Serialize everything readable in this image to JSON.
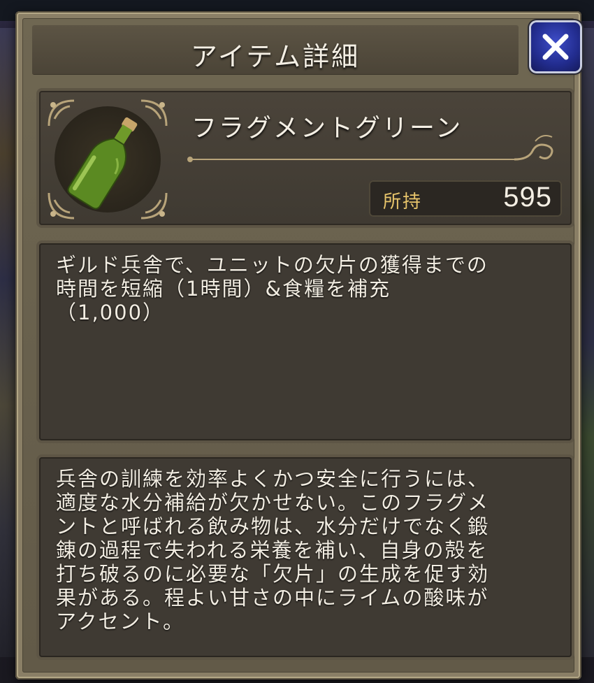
{
  "dialog": {
    "title": "アイテム詳細",
    "close_icon": "close-icon"
  },
  "item": {
    "name": "フラグメントグリーン",
    "icon": "green-bottle-icon",
    "owned_label": "所持",
    "owned_count": "595"
  },
  "effect_text": "ギルド兵舎で、ユニットの欠片の獲得までの\n時間を短縮（1時間）&食糧を補充\n（1,000）",
  "flavor_text": "兵舎の訓練を効率よくかつ安全に行うには、\n適度な水分補給が欠かせない。このフラグメ\nントと呼ばれる飲み物は、水分だけでなく鍛\n錬の過程で失われる栄養を補い、自身の殻を\n打ち破るのに必要な「欠片」の生成を促す効\n果がある。程よい甘さの中にライムの酸味が\nアクセント。",
  "colors": {
    "accent_gold": "#e8c56b",
    "close_button_blue": "#2a36a8",
    "frame_tan": "#8a7f66"
  }
}
